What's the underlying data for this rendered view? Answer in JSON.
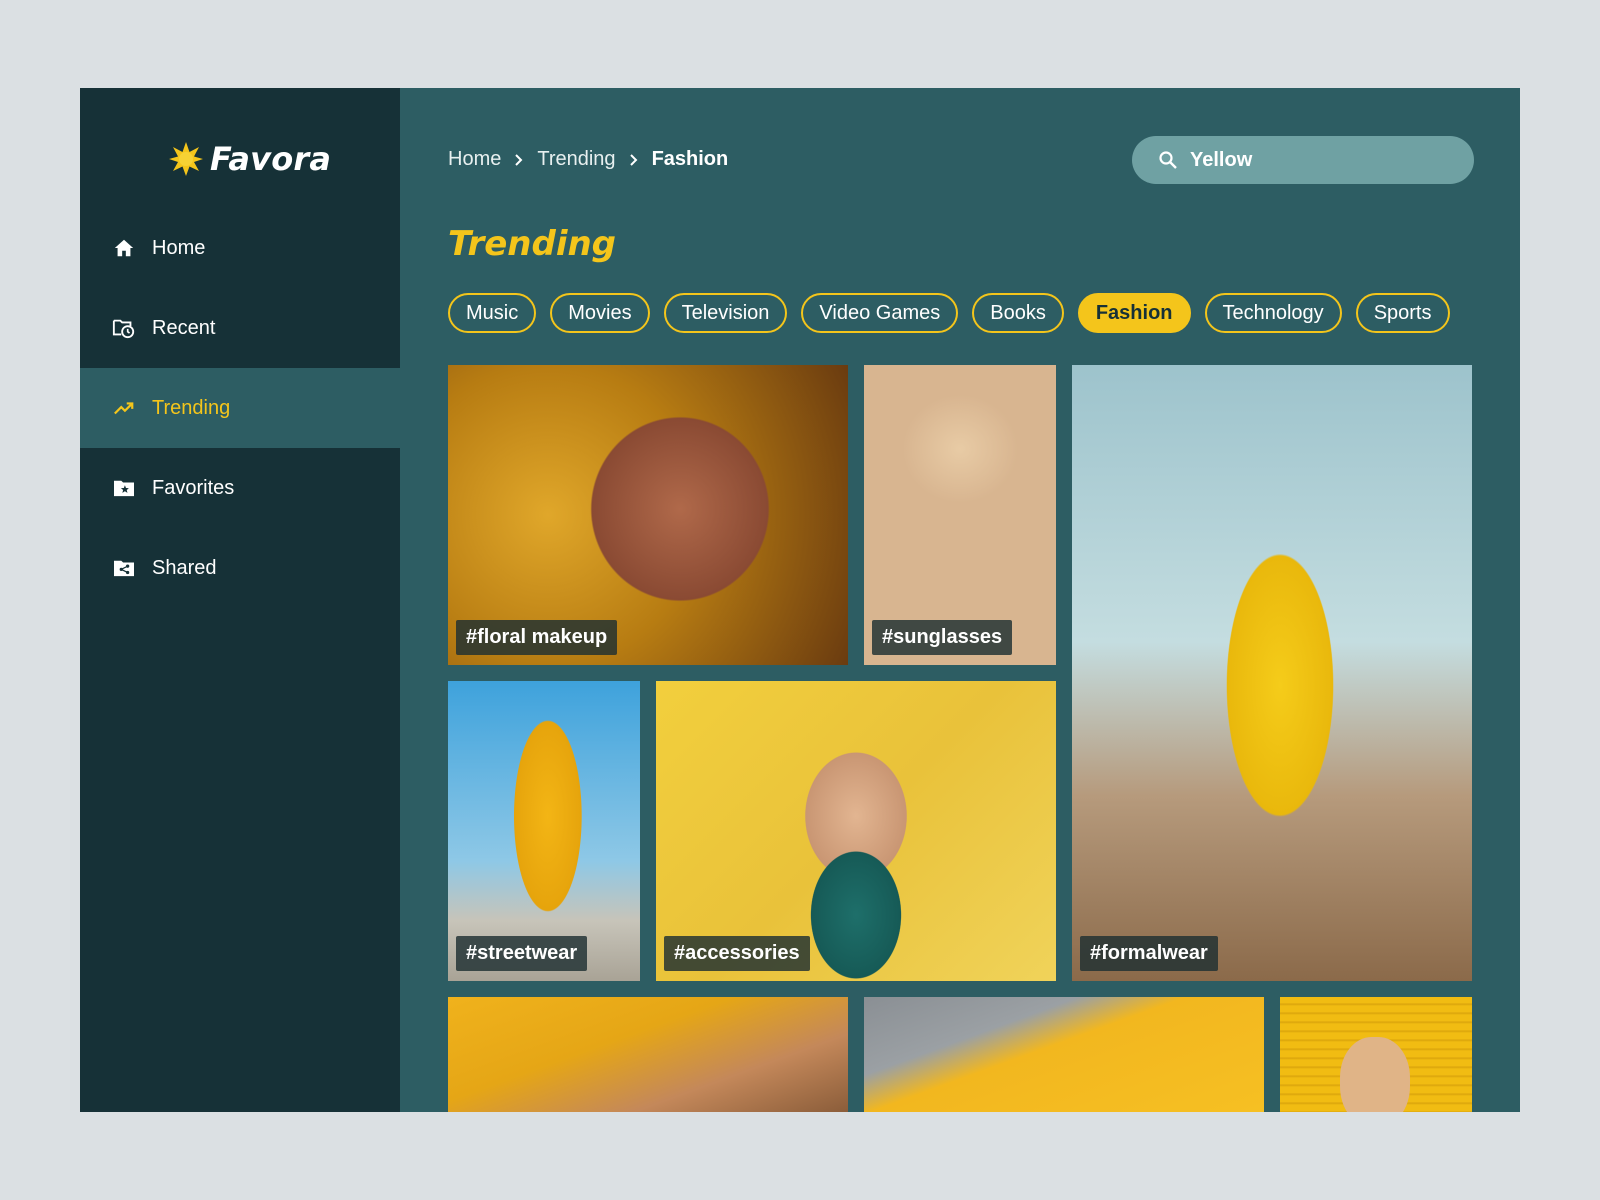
{
  "app": {
    "name": "Favora"
  },
  "sidebar": {
    "items": [
      {
        "label": "Home",
        "icon": "home-icon",
        "active": false
      },
      {
        "label": "Recent",
        "icon": "recent-folder-icon",
        "active": false
      },
      {
        "label": "Trending",
        "icon": "trending-icon",
        "active": true
      },
      {
        "label": "Favorites",
        "icon": "favorites-folder-icon",
        "active": false
      },
      {
        "label": "Shared",
        "icon": "shared-folder-icon",
        "active": false
      }
    ]
  },
  "breadcrumb": {
    "items": [
      "Home",
      "Trending",
      "Fashion"
    ]
  },
  "search": {
    "value": "Yellow",
    "icon": "search-icon"
  },
  "page": {
    "title": "Trending"
  },
  "categories": {
    "items": [
      "Music",
      "Movies",
      "Television",
      "Video Games",
      "Books",
      "Fashion",
      "Technology",
      "Sports"
    ],
    "selected": "Fashion"
  },
  "gallery": {
    "tiles": [
      {
        "tag": "#floral makeup"
      },
      {
        "tag": "#sunglasses"
      },
      {
        "tag": "#formalwear"
      },
      {
        "tag": "#streetwear"
      },
      {
        "tag": "#accessories"
      },
      {
        "tag": ""
      },
      {
        "tag": ""
      },
      {
        "tag": ""
      }
    ]
  },
  "colors": {
    "accent": "#f4c51b",
    "sidebar_bg": "#163137",
    "main_bg": "#2d5d63",
    "search_bg": "#6fa1a3"
  }
}
